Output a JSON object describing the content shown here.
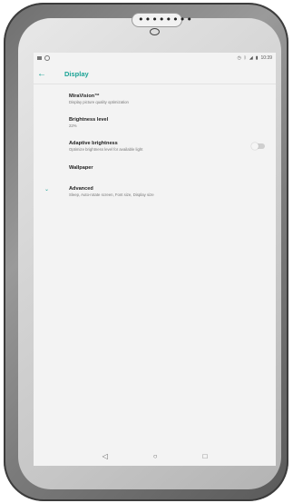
{
  "statusbar": {
    "time": "10:39",
    "icons": [
      "notification-icon",
      "circle-status-icon",
      "alarm-icon",
      "bluetooth-icon",
      "signal-icon",
      "battery-icon"
    ]
  },
  "appbar": {
    "title": "Display",
    "back_icon": "←"
  },
  "items": [
    {
      "title": "MiraVision™",
      "subtitle": "Display picture quality optimization"
    },
    {
      "title": "Brightness level",
      "subtitle": "22%"
    },
    {
      "title": "Adaptive brightness",
      "subtitle": "Optimize brightness level for available light",
      "toggle": false
    },
    {
      "title": "Wallpaper",
      "subtitle": ""
    },
    {
      "title": "Advanced",
      "subtitle": "Sleep, Auto-rotate screen, Font size, Display size"
    }
  ],
  "navbar": {
    "back": "◁",
    "home": "○",
    "recents": "□"
  },
  "colors": {
    "accent": "#1aa395"
  }
}
